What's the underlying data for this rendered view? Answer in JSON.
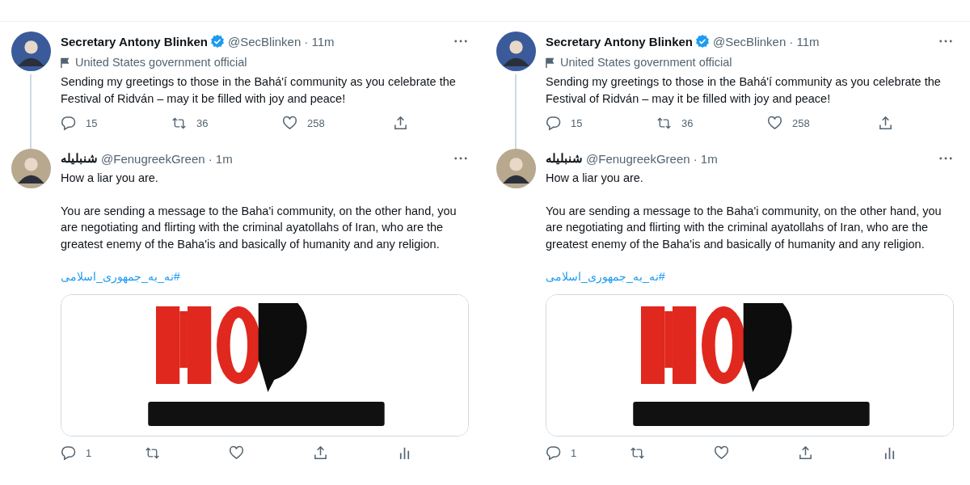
{
  "panels": [
    {
      "tweets": [
        {
          "name": "Secretary Antony Blinken",
          "verified": true,
          "handle": "@SecBlinken",
          "time": "· 11m",
          "label": "United States government official",
          "thread_line": true,
          "paragraphs": [
            "Sending my greetings to those in the Bahá'í community as you celebrate the Festival of Ridván – may it be filled with joy and peace!"
          ],
          "actions": [
            {
              "kind": "reply",
              "count": "15"
            },
            {
              "kind": "retweet",
              "count": "36"
            },
            {
              "kind": "like",
              "count": "258"
            },
            {
              "kind": "share"
            }
          ]
        },
        {
          "name": "شنبلیله",
          "verified": false,
          "handle": "@FenugreekGreen",
          "time": "· 1m",
          "thread_line": false,
          "paragraphs": [
            "How a liar you are.",
            "You are sending a message to the Baha'i community, on the other hand, you are negotiating and flirting with the criminal ayatollahs of Iran, who are the greatest enemy of the Baha'is and basically of humanity and any religion."
          ],
          "hashtag": "#نه_به_جمهوری_اسلامی",
          "actions": [
            {
              "kind": "reply",
              "count": "1"
            },
            {
              "kind": "retweet"
            },
            {
              "kind": "like"
            },
            {
              "kind": "share"
            },
            {
              "kind": "analytics"
            }
          ]
        }
      ]
    },
    {
      "tweets": [
        {
          "name": "Secretary Antony Blinken",
          "verified": true,
          "handle": "@SecBlinken",
          "time": "· 11m",
          "label": "United States government official",
          "thread_line": true,
          "paragraphs": [
            "Sending my greetings to those in the Bahá'í community as you celebrate the Festival of Ridván – may it be filled with joy and peace!"
          ],
          "actions": [
            {
              "kind": "reply",
              "count": "15"
            },
            {
              "kind": "retweet",
              "count": "36"
            },
            {
              "kind": "like",
              "count": "258"
            },
            {
              "kind": "share"
            }
          ]
        },
        {
          "name": "شنبلیله",
          "verified": false,
          "handle": "@FenugreekGreen",
          "time": "· 1m",
          "thread_line": false,
          "paragraphs": [
            "How a liar you are.",
            "You are sending a message to the Baha'i community, on the other hand, you are negotiating and flirting with the criminal ayatollahs of Iran, who are the greatest enemy of the Baha'is and basically of humanity and any religion."
          ],
          "hashtag": "#نه_به_جمهوری_اسلامی",
          "actions": [
            {
              "kind": "reply",
              "count": "1"
            },
            {
              "kind": "retweet"
            },
            {
              "kind": "like"
            },
            {
              "kind": "share"
            },
            {
              "kind": "analytics"
            }
          ]
        }
      ]
    }
  ]
}
